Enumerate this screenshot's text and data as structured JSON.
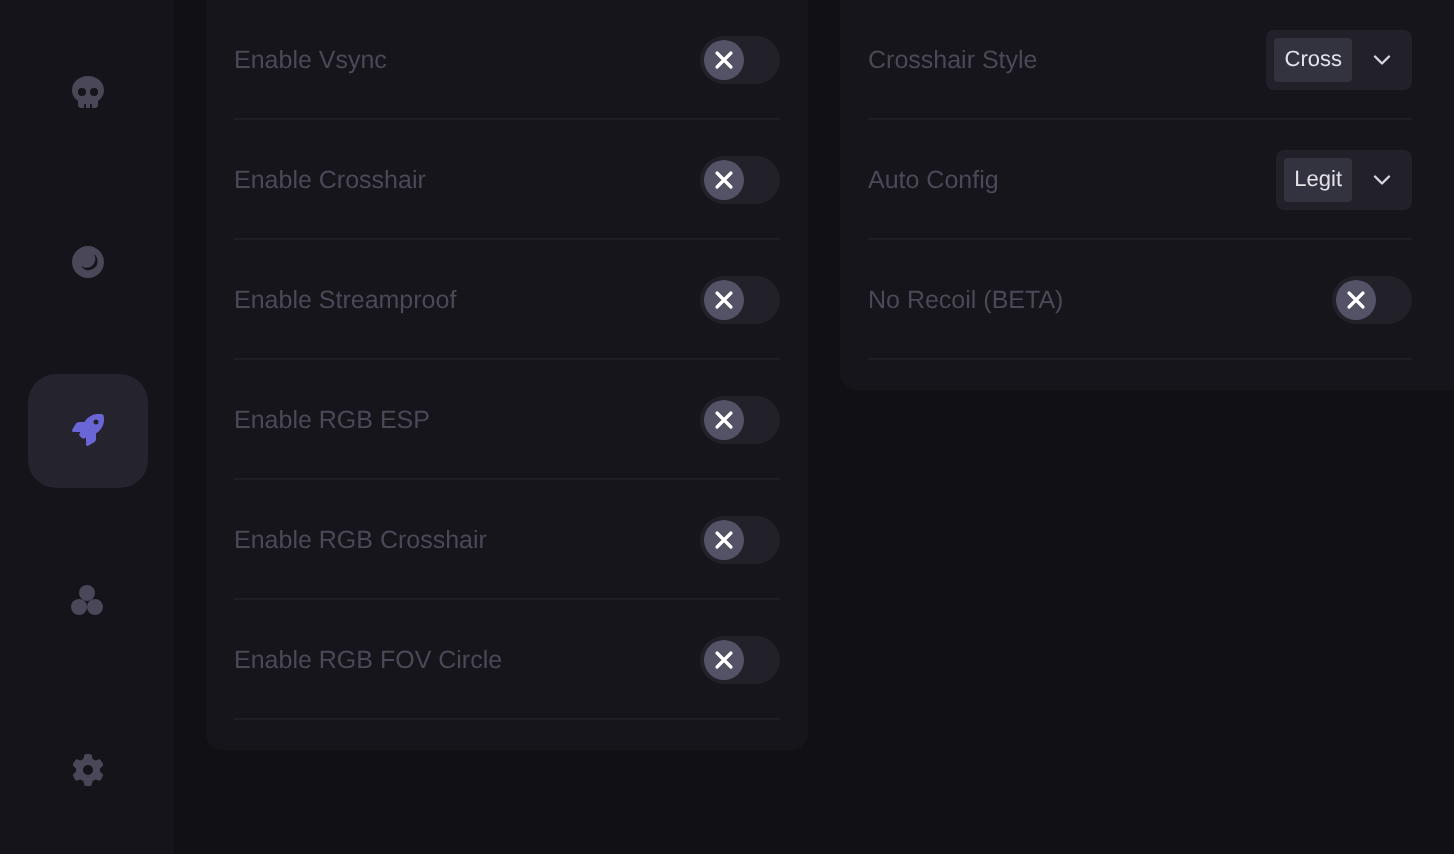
{
  "sidebar": {
    "items": [
      {
        "selected": false
      },
      {
        "selected": false
      },
      {
        "selected": true
      },
      {
        "selected": false
      },
      {
        "selected": false
      }
    ]
  },
  "left_panel": {
    "rows": [
      {
        "kind": "toggle",
        "label": "Enable Vsync",
        "on": false
      },
      {
        "kind": "toggle",
        "label": "Enable Crosshair",
        "on": false
      },
      {
        "kind": "toggle",
        "label": "Enable Streamproof",
        "on": false
      },
      {
        "kind": "toggle",
        "label": "Enable RGB ESP",
        "on": false
      },
      {
        "kind": "toggle",
        "label": "Enable RGB Crosshair",
        "on": false
      },
      {
        "kind": "toggle",
        "label": "Enable RGB FOV Circle",
        "on": false
      }
    ]
  },
  "right_panel": {
    "rows": [
      {
        "kind": "select",
        "label": "Crosshair Style",
        "value": "Cross"
      },
      {
        "kind": "select",
        "label": "Auto Config",
        "value": "Legit"
      },
      {
        "kind": "toggle",
        "label": "No Recoil (BETA)",
        "on": false
      }
    ]
  }
}
